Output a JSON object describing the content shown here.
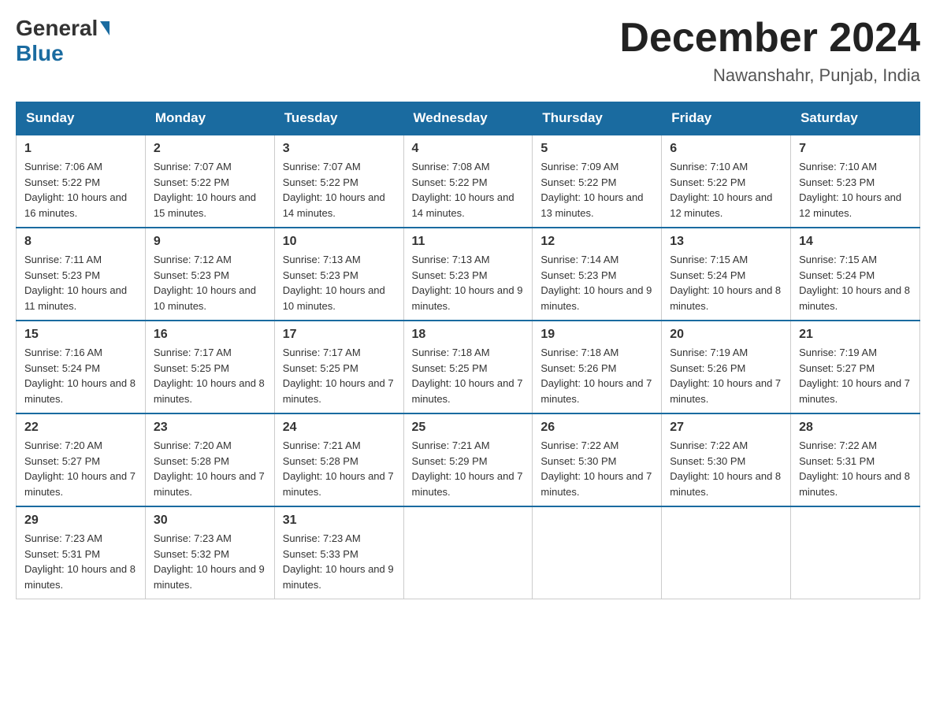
{
  "logo": {
    "general": "General",
    "blue": "Blue"
  },
  "title": "December 2024",
  "location": "Nawanshahr, Punjab, India",
  "days_of_week": [
    "Sunday",
    "Monday",
    "Tuesday",
    "Wednesday",
    "Thursday",
    "Friday",
    "Saturday"
  ],
  "weeks": [
    [
      {
        "day": "1",
        "sunrise": "7:06 AM",
        "sunset": "5:22 PM",
        "daylight": "10 hours and 16 minutes."
      },
      {
        "day": "2",
        "sunrise": "7:07 AM",
        "sunset": "5:22 PM",
        "daylight": "10 hours and 15 minutes."
      },
      {
        "day": "3",
        "sunrise": "7:07 AM",
        "sunset": "5:22 PM",
        "daylight": "10 hours and 14 minutes."
      },
      {
        "day": "4",
        "sunrise": "7:08 AM",
        "sunset": "5:22 PM",
        "daylight": "10 hours and 14 minutes."
      },
      {
        "day": "5",
        "sunrise": "7:09 AM",
        "sunset": "5:22 PM",
        "daylight": "10 hours and 13 minutes."
      },
      {
        "day": "6",
        "sunrise": "7:10 AM",
        "sunset": "5:22 PM",
        "daylight": "10 hours and 12 minutes."
      },
      {
        "day": "7",
        "sunrise": "7:10 AM",
        "sunset": "5:23 PM",
        "daylight": "10 hours and 12 minutes."
      }
    ],
    [
      {
        "day": "8",
        "sunrise": "7:11 AM",
        "sunset": "5:23 PM",
        "daylight": "10 hours and 11 minutes."
      },
      {
        "day": "9",
        "sunrise": "7:12 AM",
        "sunset": "5:23 PM",
        "daylight": "10 hours and 10 minutes."
      },
      {
        "day": "10",
        "sunrise": "7:13 AM",
        "sunset": "5:23 PM",
        "daylight": "10 hours and 10 minutes."
      },
      {
        "day": "11",
        "sunrise": "7:13 AM",
        "sunset": "5:23 PM",
        "daylight": "10 hours and 9 minutes."
      },
      {
        "day": "12",
        "sunrise": "7:14 AM",
        "sunset": "5:23 PM",
        "daylight": "10 hours and 9 minutes."
      },
      {
        "day": "13",
        "sunrise": "7:15 AM",
        "sunset": "5:24 PM",
        "daylight": "10 hours and 8 minutes."
      },
      {
        "day": "14",
        "sunrise": "7:15 AM",
        "sunset": "5:24 PM",
        "daylight": "10 hours and 8 minutes."
      }
    ],
    [
      {
        "day": "15",
        "sunrise": "7:16 AM",
        "sunset": "5:24 PM",
        "daylight": "10 hours and 8 minutes."
      },
      {
        "day": "16",
        "sunrise": "7:17 AM",
        "sunset": "5:25 PM",
        "daylight": "10 hours and 8 minutes."
      },
      {
        "day": "17",
        "sunrise": "7:17 AM",
        "sunset": "5:25 PM",
        "daylight": "10 hours and 7 minutes."
      },
      {
        "day": "18",
        "sunrise": "7:18 AM",
        "sunset": "5:25 PM",
        "daylight": "10 hours and 7 minutes."
      },
      {
        "day": "19",
        "sunrise": "7:18 AM",
        "sunset": "5:26 PM",
        "daylight": "10 hours and 7 minutes."
      },
      {
        "day": "20",
        "sunrise": "7:19 AM",
        "sunset": "5:26 PM",
        "daylight": "10 hours and 7 minutes."
      },
      {
        "day": "21",
        "sunrise": "7:19 AM",
        "sunset": "5:27 PM",
        "daylight": "10 hours and 7 minutes."
      }
    ],
    [
      {
        "day": "22",
        "sunrise": "7:20 AM",
        "sunset": "5:27 PM",
        "daylight": "10 hours and 7 minutes."
      },
      {
        "day": "23",
        "sunrise": "7:20 AM",
        "sunset": "5:28 PM",
        "daylight": "10 hours and 7 minutes."
      },
      {
        "day": "24",
        "sunrise": "7:21 AM",
        "sunset": "5:28 PM",
        "daylight": "10 hours and 7 minutes."
      },
      {
        "day": "25",
        "sunrise": "7:21 AM",
        "sunset": "5:29 PM",
        "daylight": "10 hours and 7 minutes."
      },
      {
        "day": "26",
        "sunrise": "7:22 AM",
        "sunset": "5:30 PM",
        "daylight": "10 hours and 7 minutes."
      },
      {
        "day": "27",
        "sunrise": "7:22 AM",
        "sunset": "5:30 PM",
        "daylight": "10 hours and 8 minutes."
      },
      {
        "day": "28",
        "sunrise": "7:22 AM",
        "sunset": "5:31 PM",
        "daylight": "10 hours and 8 minutes."
      }
    ],
    [
      {
        "day": "29",
        "sunrise": "7:23 AM",
        "sunset": "5:31 PM",
        "daylight": "10 hours and 8 minutes."
      },
      {
        "day": "30",
        "sunrise": "7:23 AM",
        "sunset": "5:32 PM",
        "daylight": "10 hours and 9 minutes."
      },
      {
        "day": "31",
        "sunrise": "7:23 AM",
        "sunset": "5:33 PM",
        "daylight": "10 hours and 9 minutes."
      },
      null,
      null,
      null,
      null
    ]
  ]
}
